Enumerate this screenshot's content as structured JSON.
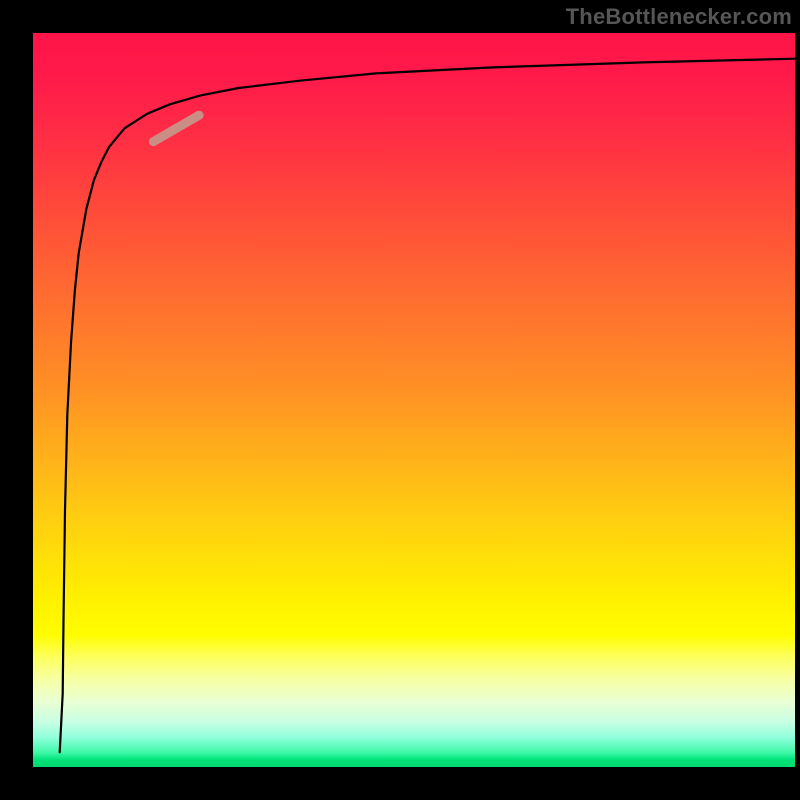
{
  "watermark": "TheBottlenecker.com",
  "colors": {
    "frame": "#000000",
    "curve": "#000000",
    "highlight": "#cb8e84",
    "watermark_text": "#565656"
  },
  "chart_data": {
    "type": "line",
    "title": "",
    "xlabel": "",
    "ylabel": "",
    "xlim": [
      0,
      100
    ],
    "ylim": [
      0,
      100
    ],
    "series": [
      {
        "name": "curve",
        "x": [
          3.5,
          3.9,
          4.0,
          4.2,
          4.5,
          5.0,
          5.5,
          6.0,
          7.0,
          8.0,
          9.0,
          10.0,
          12.0,
          15.0,
          18.0,
          22.0,
          27.0,
          35.0,
          45.0,
          60.0,
          80.0,
          100.0
        ],
        "y": [
          2.0,
          10.0,
          20.0,
          35.0,
          48.0,
          58.0,
          65.0,
          70.0,
          76.0,
          80.0,
          82.5,
          84.5,
          87.0,
          89.0,
          90.3,
          91.5,
          92.5,
          93.5,
          94.5,
          95.3,
          96.0,
          96.5
        ]
      }
    ],
    "highlight_segment": {
      "x": [
        15.8,
        21.8
      ],
      "y": [
        85.2,
        88.8
      ]
    },
    "background_gradient": {
      "orientation": "vertical",
      "stops": [
        {
          "pos": 0.0,
          "color": "#ff1447"
        },
        {
          "pos": 0.35,
          "color": "#ff6d30"
        },
        {
          "pos": 0.65,
          "color": "#ffcf10"
        },
        {
          "pos": 0.82,
          "color": "#fffd00"
        },
        {
          "pos": 0.94,
          "color": "#c6ffe4"
        },
        {
          "pos": 1.0,
          "color": "#00da6e"
        }
      ]
    }
  }
}
